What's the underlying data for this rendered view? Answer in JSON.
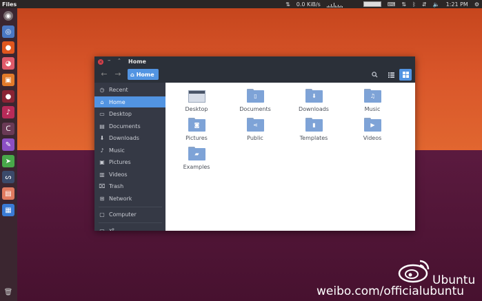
{
  "topbar": {
    "app_title": "Files",
    "net_speed": "0.0 KiB/s",
    "time": "1:21 PM"
  },
  "launcher": {
    "items": [
      "ubuntu-logo-icon",
      "chromium-icon",
      "firefox-icon",
      "owl-icon",
      "store-icon",
      "record-icon",
      "music-icon",
      "curve-icon",
      "paint-icon",
      "telegram-icon",
      "steam-icon",
      "app-icon",
      "files-icon",
      "trash-icon"
    ]
  },
  "window": {
    "title": "Home",
    "breadcrumb": "Home",
    "sidebar": [
      {
        "label": "Recent",
        "icon": "clock-icon"
      },
      {
        "label": "Home",
        "icon": "home-icon"
      },
      {
        "label": "Desktop",
        "icon": "desktop-icon"
      },
      {
        "label": "Documents",
        "icon": "document-icon"
      },
      {
        "label": "Downloads",
        "icon": "download-icon"
      },
      {
        "label": "Music",
        "icon": "music-icon"
      },
      {
        "label": "Pictures",
        "icon": "picture-icon"
      },
      {
        "label": "Videos",
        "icon": "video-icon"
      },
      {
        "label": "Trash",
        "icon": "trash-icon"
      },
      {
        "label": "Network",
        "icon": "network-icon"
      },
      {
        "label": "Computer",
        "icon": "computer-icon"
      },
      {
        "label": "xt",
        "icon": "drive-icon"
      }
    ],
    "files": [
      {
        "label": "Desktop",
        "icon": "desktop-folder-icon"
      },
      {
        "label": "Documents",
        "icon": "documents-folder-icon"
      },
      {
        "label": "Downloads",
        "icon": "downloads-folder-icon"
      },
      {
        "label": "Music",
        "icon": "music-folder-icon"
      },
      {
        "label": "Pictures",
        "icon": "pictures-folder-icon"
      },
      {
        "label": "Public",
        "icon": "public-folder-icon"
      },
      {
        "label": "Templates",
        "icon": "templates-folder-icon"
      },
      {
        "label": "Videos",
        "icon": "videos-folder-icon"
      },
      {
        "label": "Examples",
        "icon": "examples-folder-icon"
      }
    ]
  },
  "watermark": {
    "brand": "Ubuntu",
    "url": "weibo.com/officialubuntu"
  },
  "colors": {
    "accent": "#5294e2",
    "sidebar_bg": "#353945",
    "titlebar_bg": "#2b3039",
    "folder": "#7ea3d7"
  }
}
